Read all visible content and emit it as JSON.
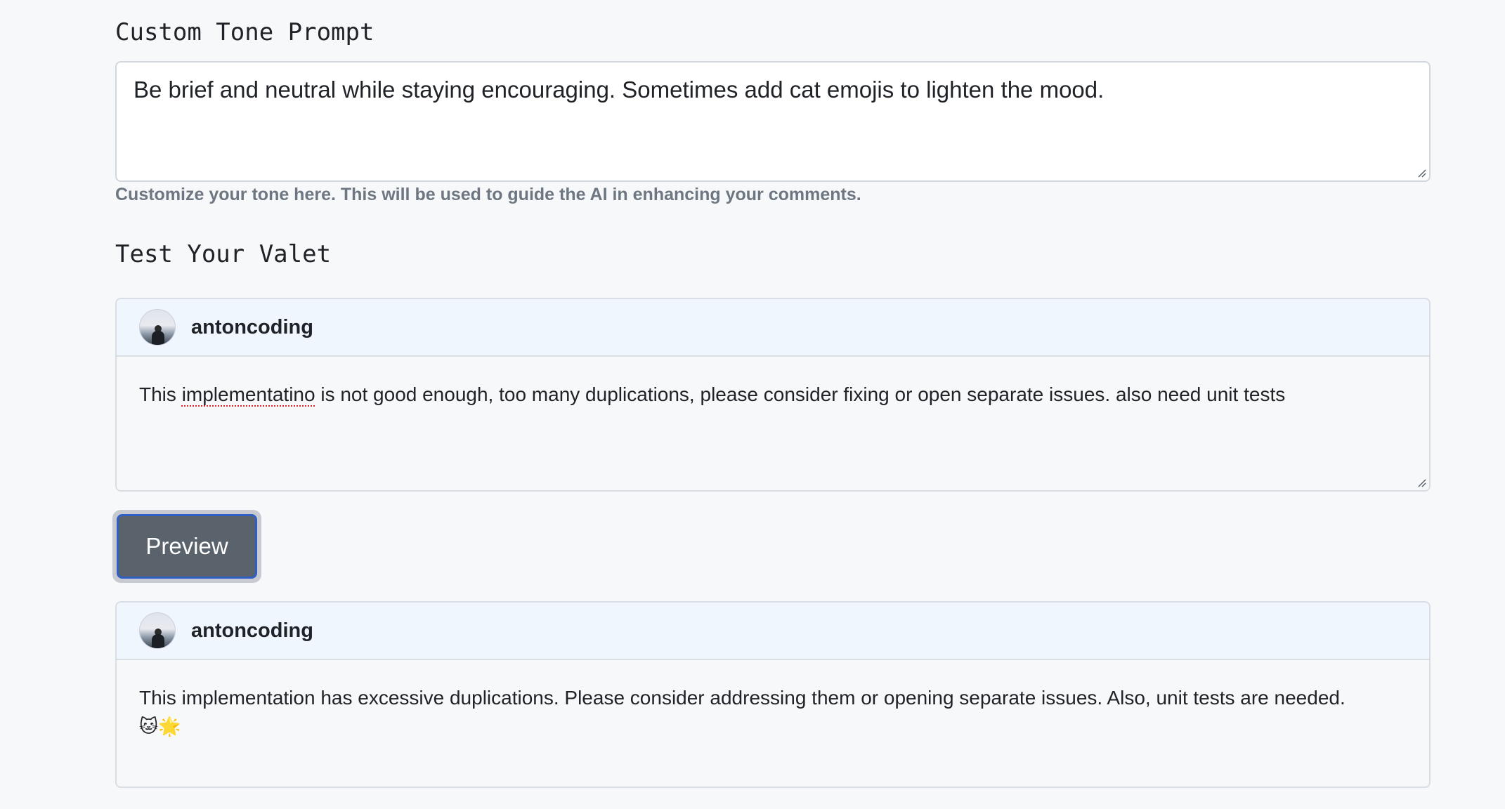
{
  "tone_section": {
    "title": "Custom Tone Prompt",
    "value": "Be brief and neutral while staying encouraging. Sometimes add cat emojis to lighten the mood.",
    "hint": "Customize your tone here. This will be used to guide the AI in enhancing your comments."
  },
  "test_section": {
    "title": "Test Your Valet",
    "input_card": {
      "username": "antoncoding",
      "text_before": "This ",
      "text_typo": "implementatino",
      "text_after": " is not good enough, too many duplications, please consider fixing or open separate issues. also need unit tests"
    },
    "preview_label": "Preview",
    "output_card": {
      "username": "antoncoding",
      "text": "This implementation has excessive duplications. Please consider addressing them or opening separate issues. Also, unit tests are needed.",
      "emojis": "🐱🌟"
    }
  },
  "icons": {
    "avatar": "avatar-photo",
    "resize": "resize-grip-icon"
  }
}
